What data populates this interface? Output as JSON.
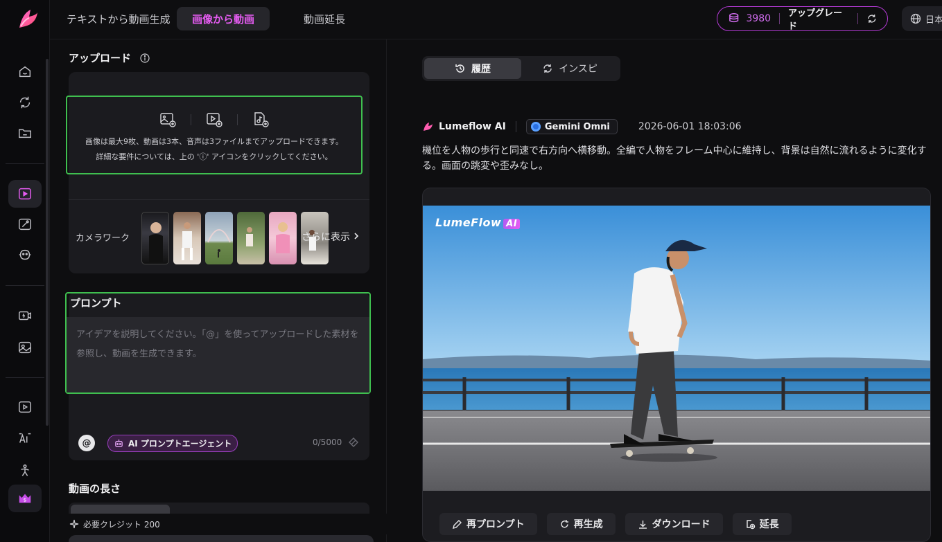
{
  "topbar": {
    "tabs": [
      {
        "label": "テキストから動画生成",
        "active": false
      },
      {
        "label": "画像から動画",
        "active": true
      },
      {
        "label": "動画延長",
        "active": false
      }
    ],
    "credits": "3980",
    "upgrade_label": "アップグレード",
    "language": "日本"
  },
  "sidebar": {
    "items": [
      "home-icon",
      "loop-icon",
      "folder-icon",
      "image-to-video-icon",
      "image-edit-icon",
      "avatar-face-icon",
      "video-effect-icon",
      "photo-icon",
      "video-play-icon",
      "ai-text-icon",
      "dance-person-icon",
      "crown-dollar-icon"
    ],
    "active": "image-to-video-icon"
  },
  "upload": {
    "title": "アップロード",
    "hint_line1": "画像は最大9枚、動画は3本、音声は3ファイルまでアップロードできます。",
    "hint_line2": "詳細な要件については、上の 'ⓘ' アイコンをクリックしてください。",
    "camera_label": "カメラワーク",
    "more_label": "さらに表示"
  },
  "prompt": {
    "title": "プロンプト",
    "placeholder": "アイデアを説明してください。「@」を使ってアップロードした素材を参照し、動画を生成できます。",
    "at_label": "@",
    "agent_label": "AI プロンプトエージェント",
    "count": "0/5000"
  },
  "duration": {
    "title": "動画の長さ"
  },
  "credit_required": "必要クレジット 200",
  "history": {
    "tabs": [
      {
        "label": "履歴",
        "active": true
      },
      {
        "label": "インスピ",
        "active": false
      }
    ],
    "brand": "Lumeflow AI",
    "model": "Gemini Omni",
    "timestamp": "2026-06-01 18:03:06",
    "description": "機位を人物の歩行と同速で右方向へ横移動。全編で人物をフレーム中心に維持し、背景は自然に流れるように変化する。画面の跳変や歪みなし。",
    "watermark_text": "LumeFlow",
    "watermark_ai": "AI",
    "actions": [
      "再プロンプト",
      "再生成",
      "ダウンロード",
      "延長"
    ]
  },
  "colors": {
    "accent": "#e65cf2",
    "highlight_border": "#3fbf4f",
    "background": "#0e0e10",
    "card": "#1b1b1f"
  }
}
